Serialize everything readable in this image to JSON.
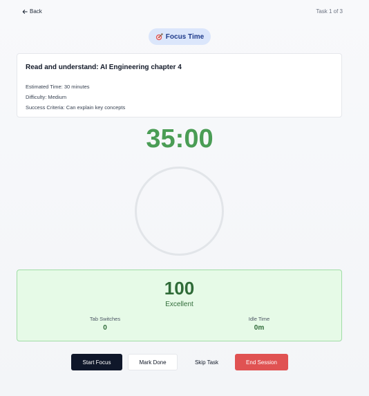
{
  "header": {
    "back_label": "Back",
    "task_count": "Task 1 of 3"
  },
  "mode_badge": {
    "label": "Focus Time",
    "icon": "target-icon"
  },
  "task": {
    "title": "Read and understand: AI Engineering chapter 4",
    "estimated_time_label": "Estimated Time:",
    "estimated_time_value": "30 minutes",
    "difficulty_label": "Difficulty:",
    "difficulty_value": "Medium",
    "success_label": "Success Criteria:",
    "success_value": "Can explain key concepts"
  },
  "timer": {
    "display": "35:00",
    "color": "#4a9d55",
    "progress": 0
  },
  "score": {
    "value": "100",
    "label": "Excellent",
    "tab_switches_label": "Tab Switches",
    "tab_switches_value": "0",
    "idle_time_label": "Idle Time",
    "idle_time_value": "0m"
  },
  "actions": {
    "start_label": "Start Focus",
    "done_label": "Mark Done",
    "skip_label": "Skip Task",
    "end_label": "End Session"
  },
  "colors": {
    "accent_green": "#4a9d55",
    "danger": "#e05252",
    "primary_dark": "#0f172a",
    "badge_bg": "#dbe6fb"
  }
}
